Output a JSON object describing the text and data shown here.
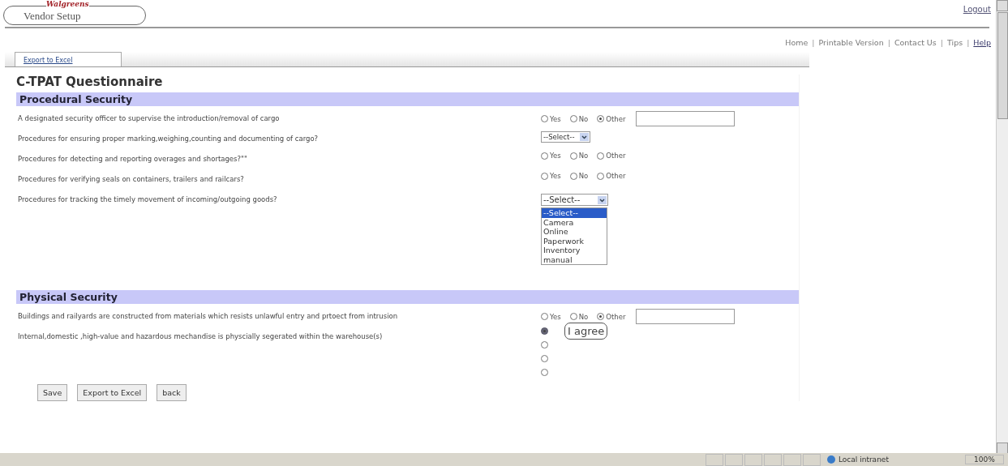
{
  "header": {
    "brand": "Walgreens",
    "app_title": "Vendor Setup",
    "logout": "Logout"
  },
  "nav_separator": "|",
  "nav_links": [
    {
      "label": "Home",
      "link": false
    },
    {
      "label": "Printable Version",
      "link": false
    },
    {
      "label": "Contact Us",
      "link": false
    },
    {
      "label": "Tips",
      "link": false
    },
    {
      "label": "Help",
      "link": true
    }
  ],
  "tabs": [
    {
      "label": "Export to Excel",
      "selected": true
    }
  ],
  "title": "C-TPAT Questionnaire",
  "sections": [
    {
      "title": "Procedural Security",
      "questions": [
        {
          "text": "A designated security officer to supervise the introduction/removal of cargo",
          "kind": "radio-field",
          "options": [
            {
              "label": "Yes",
              "selected": false
            },
            {
              "label": "No",
              "selected": false
            },
            {
              "label": "Other",
              "selected": true
            }
          ]
        },
        {
          "text": "Procedures for ensuring proper marking,weighing,counting and documenting of cargo?",
          "kind": "select",
          "value": "--Select--"
        },
        {
          "text": "Procedures for detecting and reporting overages and shortages?\"\"",
          "kind": "radio",
          "options": [
            {
              "label": "Yes",
              "selected": false
            },
            {
              "label": "No",
              "selected": false
            },
            {
              "label": "Other",
              "selected": false
            }
          ]
        },
        {
          "text": "Procedures for verifying seals on containers, trailers and railcars?",
          "kind": "radio",
          "options": [
            {
              "label": "Yes",
              "selected": false
            },
            {
              "label": "No",
              "selected": false
            },
            {
              "label": "Other",
              "selected": false
            }
          ]
        },
        {
          "text": "Procedures for tracking the timely movement of incoming/outgoing goods?",
          "kind": "select-open",
          "value": "--Select--",
          "items": [
            {
              "label": "--Select--",
              "selected": true
            },
            {
              "label": "Camera",
              "selected": false
            },
            {
              "label": "Online",
              "selected": false
            },
            {
              "label": "Paperwork",
              "selected": false
            },
            {
              "label": "Inventory",
              "selected": false
            },
            {
              "label": "manual",
              "selected": false
            }
          ]
        }
      ]
    },
    {
      "title": "Physical Security",
      "questions": [
        {
          "text": "Buildings and railyards are constructed from materials which resists unlawful entry and prtoect from intrusion",
          "kind": "radio-field",
          "options": [
            {
              "label": "Yes",
              "selected": false
            },
            {
              "label": "No",
              "selected": false
            },
            {
              "label": "Other",
              "selected": true
            }
          ]
        },
        {
          "text": "Internal,domestic ,high-value and hazardous mechandise is physcially segerated within the warehouse(s)",
          "kind": "radio-column",
          "tooltip": "I agree",
          "options": [
            {
              "selected": true
            },
            {
              "selected": false
            },
            {
              "selected": false
            },
            {
              "selected": false
            }
          ]
        }
      ]
    }
  ],
  "buttons": [
    "Save",
    "Export to Excel",
    "back"
  ],
  "status_bar": {
    "zone": "Local intranet",
    "zoom": "100%"
  }
}
